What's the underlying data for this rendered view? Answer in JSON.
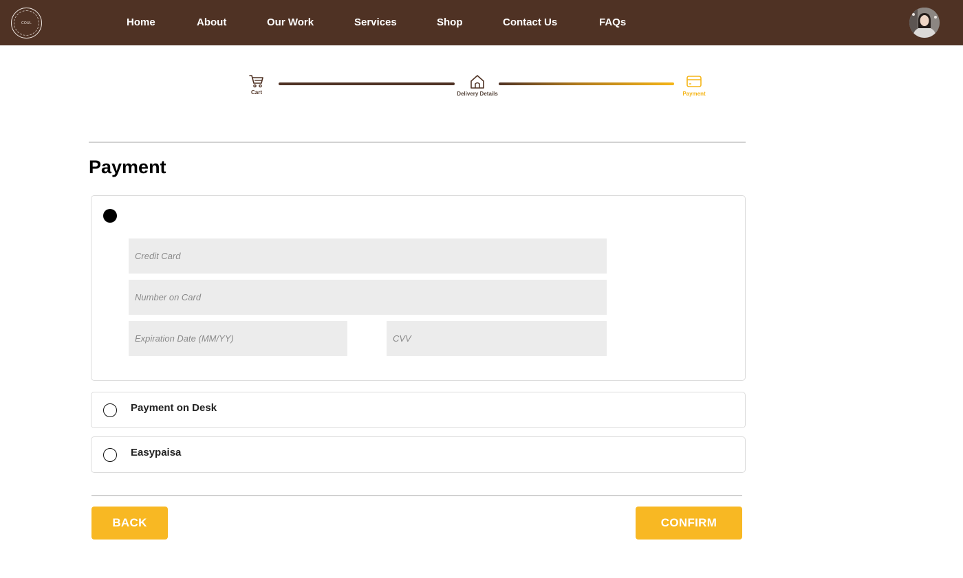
{
  "navbar": {
    "logo_text": "COUL",
    "links": [
      "Home",
      "About",
      "Our Work",
      "Services",
      "Shop",
      "Contact Us",
      "FAQs"
    ]
  },
  "stepper": {
    "steps": [
      {
        "label": "Cart",
        "icon": "cart-icon",
        "color": "#4f3224"
      },
      {
        "label": "Delivery Details",
        "icon": "home-icon",
        "color": "#4f3224"
      },
      {
        "label": "Payment",
        "icon": "credit-card-icon",
        "color": "#f5b518"
      }
    ]
  },
  "payment": {
    "title": "Payment",
    "credit_card": {
      "selected": true,
      "fields": {
        "card_type": {
          "placeholder": "Credit Card",
          "value": ""
        },
        "card_number": {
          "placeholder": "Number on Card",
          "value": ""
        },
        "expiration": {
          "placeholder": "Expiration Date (MM/YY)",
          "value": ""
        },
        "cvv": {
          "placeholder": "CVV",
          "value": ""
        }
      }
    },
    "options": [
      {
        "label": "Payment on Desk",
        "selected": false
      },
      {
        "label": "Easypaisa",
        "selected": false
      }
    ]
  },
  "actions": {
    "back_label": "BACK",
    "confirm_label": "CONFIRM"
  },
  "colors": {
    "brand_brown": "#4f3224",
    "accent_yellow": "#f8b823",
    "field_bg": "#ececec"
  }
}
